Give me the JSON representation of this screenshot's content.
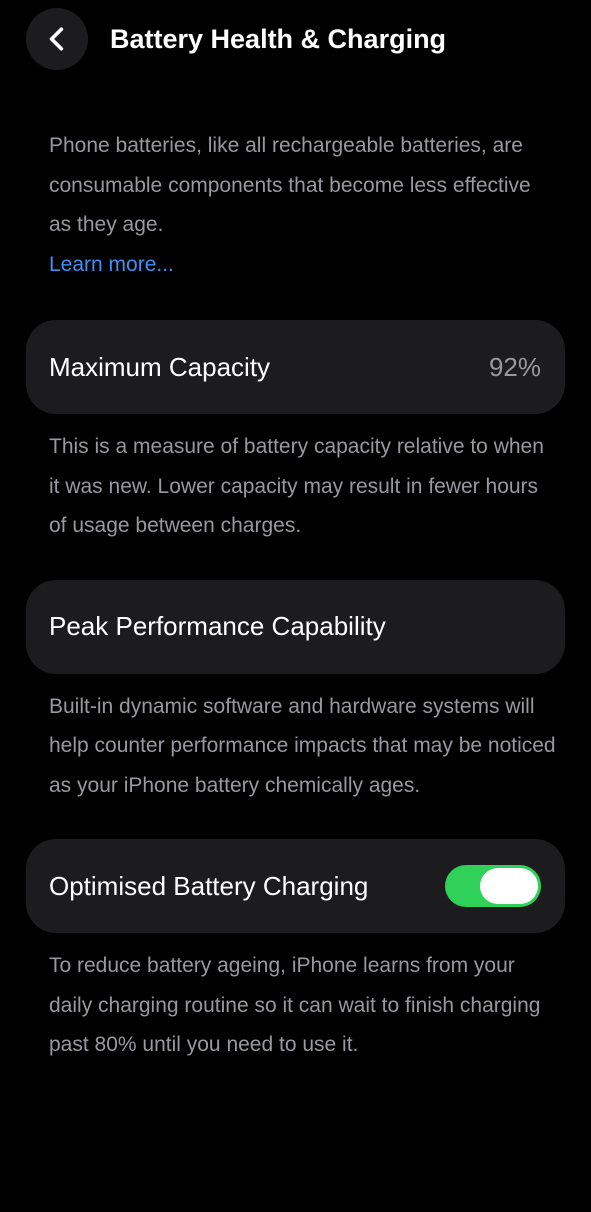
{
  "header": {
    "title": "Battery Health & Charging",
    "back_icon": "chevron-left-icon"
  },
  "intro": {
    "text": "Phone batteries, like all rechargeable batteries, are consumable components that become less effective as they age.",
    "link": "Learn more..."
  },
  "max_capacity": {
    "label": "Maximum Capacity",
    "value": "92%",
    "description": "This is a measure of battery capacity relative to when it was new. Lower capacity may result in fewer hours of usage between charges."
  },
  "peak_performance": {
    "label": "Peak Performance Capability",
    "description": "Built-in dynamic software and hardware systems will help counter performance impacts that may be noticed as your iPhone battery chemically ages."
  },
  "optimised_charging": {
    "label": "Optimised Battery Charging",
    "enabled": true,
    "description": "To reduce battery ageing, iPhone learns from your daily charging routine so it can wait to finish charging past 80% until you need to use it."
  },
  "colors": {
    "background": "#000000",
    "card": "#1c1c1e",
    "secondary_text": "#98989f",
    "link": "#3b8ff5",
    "toggle_on": "#30d158"
  }
}
